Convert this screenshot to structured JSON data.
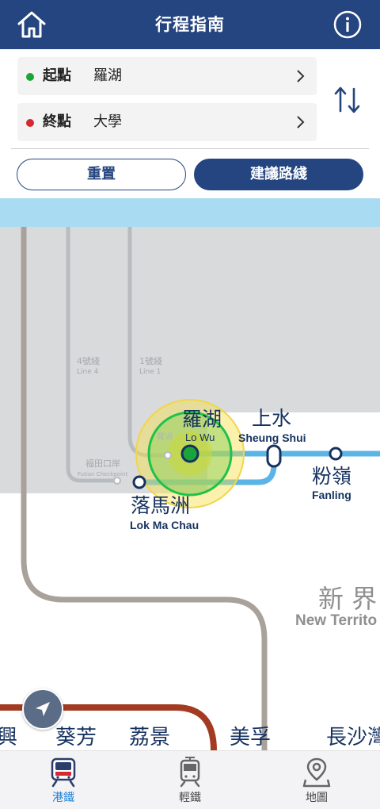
{
  "header": {
    "title": "行程指南"
  },
  "route": {
    "origin": {
      "label": "起點",
      "value": "羅湖",
      "color": "#1aa53b"
    },
    "destination": {
      "label": "終點",
      "value": "大學",
      "color": "#d7282f"
    }
  },
  "actions": {
    "reset": "重置",
    "suggest": "建議路綫"
  },
  "map": {
    "lines": {
      "line4": "4號綫",
      "line4_en": "Line 4",
      "line1": "1號綫",
      "line1_en": "Line 1"
    },
    "stations": {
      "futian_zh": "福田口岸",
      "futian_en": "Futian Checkpoint",
      "lowu_small": "羅湖",
      "lowu_zh": "羅湖",
      "lowu_en": "Lo Wu",
      "sheungshui_zh": "上水",
      "sheungshui_en": "Sheung Shui",
      "fanling_zh": "粉嶺",
      "fanling_en": "Fanling",
      "lokmachau_zh": "落馬洲",
      "lokmachau_en": "Lok Ma Chau",
      "hing_zh": "興",
      "kwaifong_zh": "葵芳",
      "laiking_zh": "荔景",
      "meifoo_zh": "美孚",
      "chsw_zh": "長沙灣"
    },
    "region": {
      "zh": "新 界",
      "en": "New Territo"
    },
    "colors": {
      "east_rail": "#5ab4e6",
      "tsuen_wan": "#a33b22",
      "boundary": "#d9dadc",
      "rail_grey": "#a9a29a",
      "highlight": "#1aa53b"
    }
  },
  "tabs": [
    {
      "label": "港鐵",
      "icon": "mtr-train-icon",
      "active": true
    },
    {
      "label": "輕鐵",
      "icon": "light-rail-icon",
      "active": false
    },
    {
      "label": "地圖",
      "icon": "map-pin-icon",
      "active": false
    }
  ]
}
